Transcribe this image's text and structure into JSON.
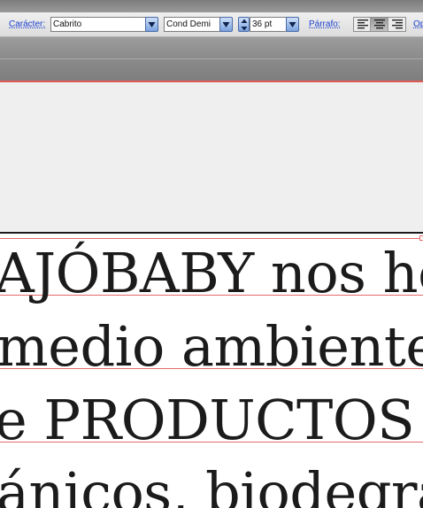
{
  "control_bar": {
    "character_label": "Carácter:",
    "font_family": "Cabrito",
    "font_style": "Cond Demi",
    "font_size": "36 pt",
    "paragraph_label": "Párrafo:",
    "options_label": "Op",
    "alignment_selected": "center"
  },
  "document": {
    "lines": [
      "AJÓBABY nos he",
      "medio ambiente,",
      "e PRODUCTOS E",
      "ánicos, biodegra"
    ]
  }
}
